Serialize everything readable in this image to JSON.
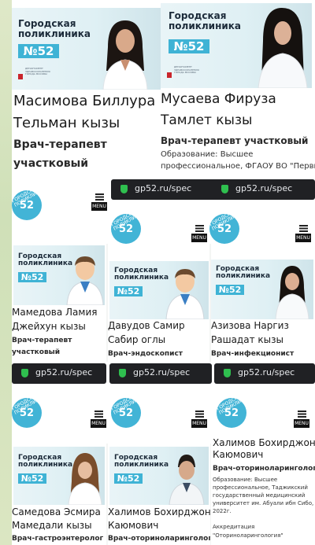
{
  "banner": {
    "city": "Городская поликлиника",
    "number": "№52"
  },
  "banner_caption": "ДЕПАРТАМЕНТ ЗДРАВООХРАНЕНИЯ ГОРОДА МОСКВЫ",
  "browser": {
    "url": "gp52.ru/spec"
  },
  "sticker": {
    "top": "ГОРОДСКАЯ ПОЛИКЛИНИКА",
    "number": "52"
  },
  "menu_label": "MENU",
  "doctors": [
    {
      "name_line1": "Масимова Биллура",
      "name_line2": "Тельман кызы",
      "role_line1": "Врач-терапевт",
      "role_line2": "участковый"
    },
    {
      "name_line1": "Мусаева Фируза",
      "name_line2": "Тамлет кызы",
      "role_line1": "Врач-терапевт участковый",
      "edu_line1": "Образование: Высшее",
      "edu_line2": "профессиональное, ФГАОУ ВО \"Первый"
    },
    {
      "name_line1": "Мамедова Ламия",
      "name_line2": "Джейхун кызы",
      "role_line1": "Врач-терапевт",
      "role_line2": "участковый"
    },
    {
      "name_line1": "Давудов Самир",
      "name_line2": "Сабир оглы",
      "role_line1": "Врач-эндоскопист"
    },
    {
      "name_line1": "Азизова Наргиз",
      "name_line2": "Рашадат кызы",
      "role_line1": "Врач-инфекционист"
    },
    {
      "name_line1": "Самедова Эсмира",
      "name_line2": "Мамедали кызы",
      "role_line1": "Врач-гастроэнтеролог"
    },
    {
      "name_line1": "Халимов Бохирджон",
      "name_line2": "Каюмович",
      "role_line1": "Врач-оториноларинголог"
    },
    {
      "name_line1": "Халимов Бохирджон",
      "name_line2": "Каюмович",
      "role_line1": "Врач-оториноларинголог",
      "edu_line1": "Образование: Высшее",
      "edu_line2": "профессиональное, Таджикский",
      "edu_line3": "государственный медицинский",
      "edu_line4": "университет им. Абуали ибн Сибо,",
      "edu_line5": "2022г.",
      "accr_line1": "Аккредитация",
      "accr_line2": "\"Оториноларингология\""
    }
  ]
}
